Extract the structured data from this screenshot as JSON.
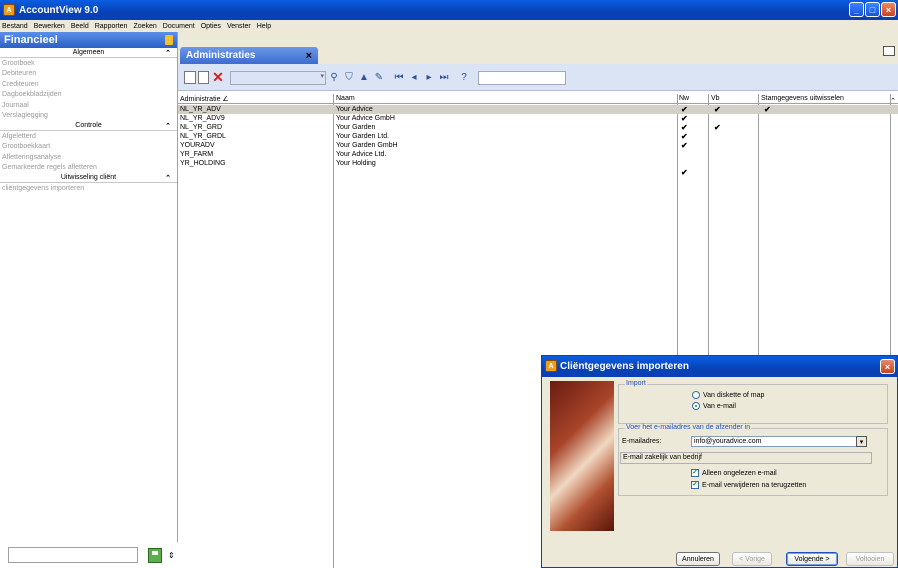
{
  "window": {
    "title": "AccountView 9.0",
    "min": "_",
    "max": "□",
    "close": "×"
  },
  "menu": [
    "Bestand",
    "Bewerken",
    "Beeld",
    "Rapporten",
    "Zoeken",
    "Document",
    "Opties",
    "Venster",
    "Help"
  ],
  "sidebar": {
    "header": "Financieel",
    "sections": [
      {
        "title": "Algemeen",
        "items": [
          "Grootboek",
          "Debiteuren",
          "Crediteuren",
          "Dagboekbladzijden",
          "Journaal",
          "Verslaglegging"
        ]
      },
      {
        "title": "Controle",
        "items": [
          "Afgeletterd",
          "Grootboekkaart",
          "Afletteringsanalyse",
          "Gemarkeerde regels afletteren"
        ]
      },
      {
        "title": "Uitwisseling cliënt",
        "items": [
          "cliëntgegevens importeren"
        ]
      }
    ]
  },
  "tab": {
    "label": "Administraties",
    "close": "×"
  },
  "grid": {
    "columns": [
      "Administratie ∠",
      "Naam",
      "Nw",
      "Vb",
      "Stamgegevens uitwisselen"
    ],
    "rows": [
      {
        "code": "NL_YR_ADV",
        "name": "Your Advice",
        "nw": "✔",
        "vb": "✔",
        "stam": "✔",
        "selected": true
      },
      {
        "code": "NL_YR_ADV9",
        "name": "Your Advice GmbH",
        "nw": "✔",
        "vb": "",
        "stam": ""
      },
      {
        "code": "NL_YR_GRD",
        "name": "Your Garden",
        "nw": "✔",
        "vb": "✔",
        "stam": ""
      },
      {
        "code": "NL_YR_GRDL",
        "name": "Your Garden Ltd.",
        "nw": "✔",
        "vb": "",
        "stam": ""
      },
      {
        "code": "YOURADV",
        "name": "Your Garden GmbH",
        "nw": "✔",
        "vb": "",
        "stam": ""
      },
      {
        "code": "YR_FARM",
        "name": "Your Advice Ltd.",
        "nw": "",
        "vb": "",
        "stam": ""
      },
      {
        "code": "YR_HOLDING",
        "name": "Your Holding",
        "nw": "✔",
        "vb": "",
        "stam": ""
      }
    ]
  },
  "dialog": {
    "title": "Cliëntgegevens importeren",
    "import_legend": "Import",
    "options": [
      {
        "label": "Van diskette of map",
        "selected": false
      },
      {
        "label": "Van e-mail",
        "selected": true
      }
    ],
    "email_legend": "Voer het e-mailadres van de afzender in",
    "email_label": "E-mailadres:",
    "email_value": "info@youradvice.com",
    "subject": "E-mail zakelijk van bedrijf",
    "checkboxes": [
      {
        "label": "Alleen ongelezen e-mail",
        "checked": true
      },
      {
        "label": "E-mail verwijderen na terugzetten",
        "checked": true
      }
    ],
    "buttons": {
      "cancel": "Annuleren",
      "back": "< Vorige",
      "next": "Volgende >",
      "finish": "Voltooien"
    }
  }
}
